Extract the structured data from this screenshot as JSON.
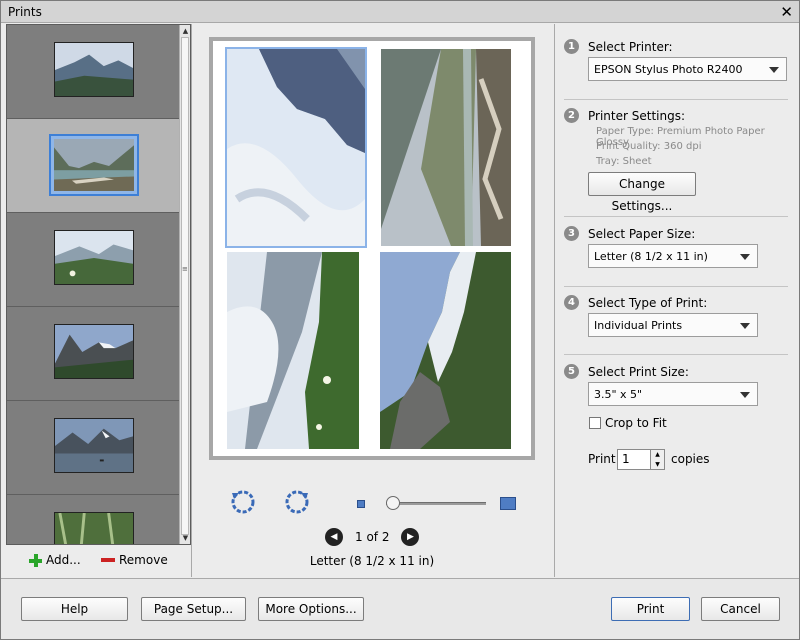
{
  "window": {
    "title": "Prints"
  },
  "thumbnails": [
    {
      "name": "mountain-lake-thumbnail",
      "selected": false
    },
    {
      "name": "valley-lake-thumbnail",
      "selected": true
    },
    {
      "name": "alpine-meadow-thumbnail",
      "selected": false
    },
    {
      "name": "glacier-peak-thumbnail",
      "selected": false
    },
    {
      "name": "lake-boat-thumbnail",
      "selected": false
    },
    {
      "name": "forest-thumbnail",
      "selected": false
    }
  ],
  "thumb_actions": {
    "add_label": "Add...",
    "remove_label": "Remove"
  },
  "preview": {
    "page_count": "1 of 2",
    "paper_label": "Letter (8 1/2 x 11 in)"
  },
  "steps": {
    "printer": {
      "number": "1",
      "label": "Select Printer:",
      "value": "EPSON Stylus Photo R2400"
    },
    "settings": {
      "number": "2",
      "label": "Printer Settings:",
      "paper_type": "Paper Type: Premium Photo Paper Glossy",
      "print_quality": "Print Quality: 360 dpi",
      "tray": "Tray: Sheet",
      "button": "Change Settings..."
    },
    "paper_size": {
      "number": "3",
      "label": "Select Paper Size:",
      "value": "Letter (8 1/2 x 11 in)"
    },
    "print_type": {
      "number": "4",
      "label": "Select Type of Print:",
      "value": "Individual Prints"
    },
    "print_size": {
      "number": "5",
      "label": "Select Print Size:",
      "value": "3.5\" x 5\""
    }
  },
  "crop_to_fit": {
    "label": "Crop to Fit",
    "checked": false
  },
  "copies": {
    "prefix": "Print",
    "value": "1",
    "suffix": "copies"
  },
  "footer": {
    "help": "Help",
    "page_setup": "Page Setup...",
    "more_options": "More Options...",
    "print": "Print",
    "cancel": "Cancel"
  }
}
